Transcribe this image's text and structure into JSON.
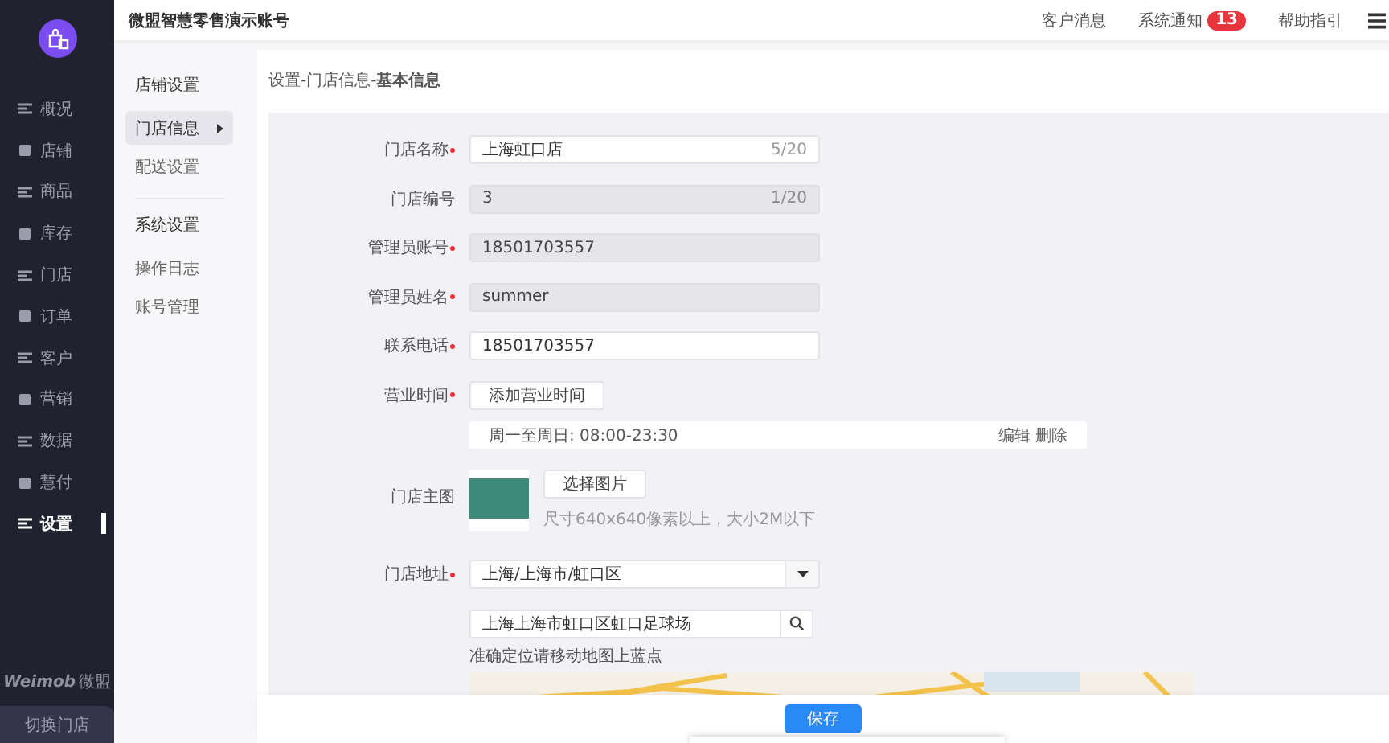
{
  "sidebar": {
    "items": [
      {
        "label": "概况",
        "selected": false
      },
      {
        "label": "店铺",
        "selected": false
      },
      {
        "label": "商品",
        "selected": false
      },
      {
        "label": "库存",
        "selected": false
      },
      {
        "label": "门店",
        "selected": false
      },
      {
        "label": "订单",
        "selected": false
      },
      {
        "label": "客户",
        "selected": false
      },
      {
        "label": "营销",
        "selected": false
      },
      {
        "label": "数据",
        "selected": false
      },
      {
        "label": "慧付",
        "selected": false
      },
      {
        "label": "设置",
        "selected": true
      }
    ],
    "brand": "Weimob",
    "brand_cn": "微盟",
    "switch_button": "切换门店"
  },
  "topbar": {
    "title": "微盟智慧零售演示账号",
    "links": [
      {
        "label": "客户消息"
      },
      {
        "label": "系统通知",
        "badge": "13"
      },
      {
        "label": "帮助指引"
      }
    ]
  },
  "subnav": {
    "groups": [
      {
        "title": "店铺设置",
        "items": [
          {
            "label": "门店信息",
            "selected": true
          },
          {
            "label": "配送设置",
            "selected": false
          }
        ]
      },
      {
        "title": "系统设置",
        "items": [
          {
            "label": "操作日志",
            "selected": false
          },
          {
            "label": "账号管理",
            "selected": false
          }
        ]
      }
    ]
  },
  "breadcrumb": "设置-门店信息-**基本信息**",
  "fields": [
    {
      "kind": "input",
      "label": "门店名称",
      "required": true,
      "value": "上海虹口店",
      "counter": "5/20",
      "disabled": false
    },
    {
      "kind": "input",
      "label": "门店编号",
      "required": false,
      "value": "3",
      "counter": "1/20",
      "disabled": true
    },
    {
      "kind": "input",
      "label": "管理员账号",
      "required": true,
      "value": "18501703557",
      "disabled": true
    },
    {
      "kind": "input",
      "label": "管理员姓名",
      "required": true,
      "value": "summer",
      "disabled": true
    },
    {
      "kind": "input",
      "label": "联系电话",
      "required": true,
      "value": "18501703557",
      "disabled": false
    },
    {
      "kind": "hours",
      "label": "营业时间",
      "required": true,
      "button": "添加营业时间",
      "entries": [
        {
          "text": "周一至周日: 08:00-23:30",
          "actions": [
            "编辑",
            "删除"
          ]
        }
      ]
    },
    {
      "kind": "image",
      "label": "门店主图",
      "required": false,
      "button": "选择图片",
      "hint": "尺寸640x640像素以上，大小2M以下"
    },
    {
      "kind": "address",
      "label": "门店地址",
      "required": true,
      "region": "上海/上海市/虹口区",
      "search_value": "上海上海市虹口区虹口足球场",
      "hint": "准确定位请移动地图上蓝点"
    }
  ],
  "save_button": "保存"
}
